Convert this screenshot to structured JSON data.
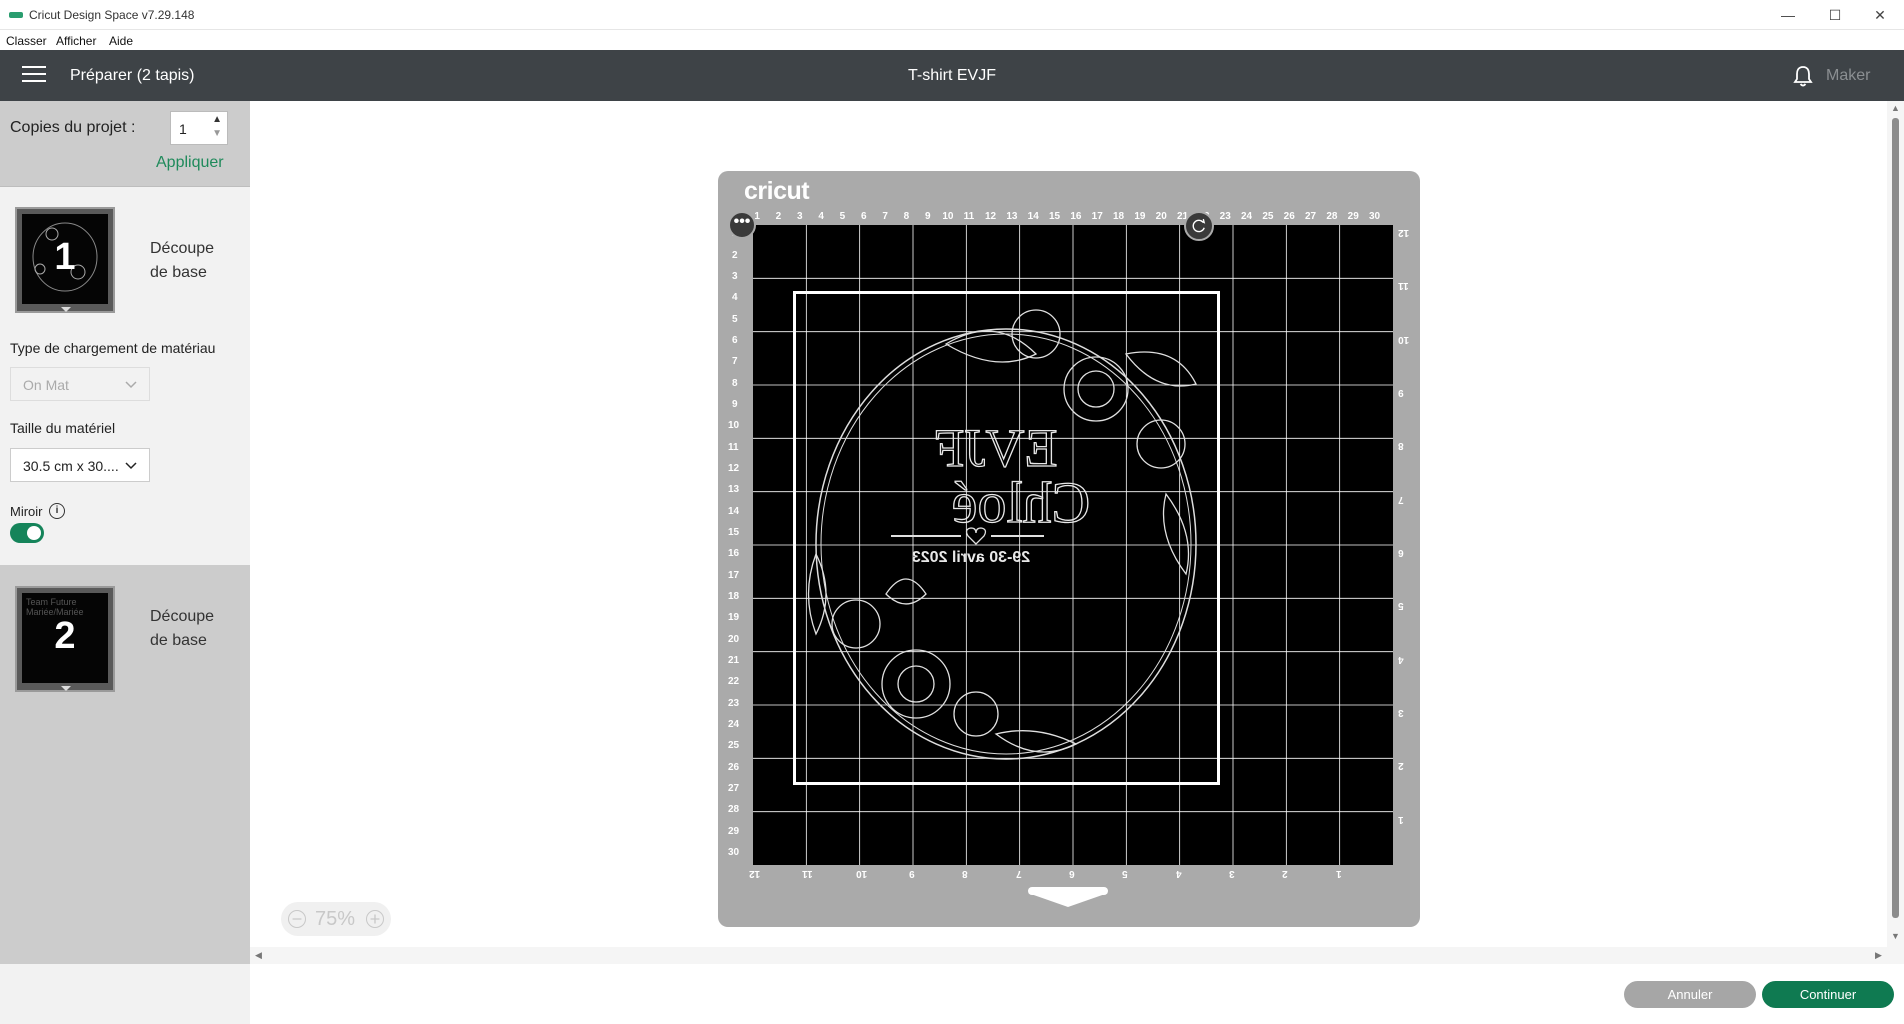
{
  "window": {
    "title": "Cricut Design Space  v7.29.148",
    "minimize": "—",
    "maximize": "☐",
    "close": "✕"
  },
  "menu": {
    "items": [
      "Classer",
      "Afficher",
      "Aide"
    ]
  },
  "header": {
    "left_title": "Préparer (2 tapis)",
    "project_title": "T-shirt EVJF",
    "machine": "Maker"
  },
  "sidebar": {
    "copies_label": "Copies du projet :",
    "copies_value": "1",
    "apply_label": "Appliquer",
    "mats": [
      {
        "number": "1",
        "label_line1": "Découpe",
        "label_line2": "de base"
      },
      {
        "number": "2",
        "label_line1": "Découpe",
        "label_line2": "de base"
      }
    ],
    "load_type_label": "Type de chargement de matériau",
    "load_type_value": "On Mat",
    "material_size_label": "Taille du matériel",
    "material_size_value": "30.5 cm x 30....",
    "mirror_label": "Miroir",
    "mirror_on": true
  },
  "mat": {
    "brand": "cricut",
    "top_ruler": [
      "1",
      "2",
      "3",
      "4",
      "5",
      "6",
      "7",
      "8",
      "9",
      "10",
      "11",
      "12",
      "13",
      "14",
      "15",
      "16",
      "17",
      "18",
      "19",
      "20",
      "21",
      "22",
      "23",
      "24",
      "25",
      "26",
      "27",
      "28",
      "29",
      "30"
    ],
    "left_ruler": [
      "1",
      "2",
      "3",
      "4",
      "5",
      "6",
      "7",
      "8",
      "9",
      "10",
      "11",
      "12",
      "13",
      "14",
      "15",
      "16",
      "17",
      "18",
      "19",
      "20",
      "21",
      "22",
      "23",
      "24",
      "25",
      "26",
      "27",
      "28",
      "29",
      "30"
    ],
    "right_ruler": [
      "12",
      "11",
      "10",
      "9",
      "8",
      "7",
      "6",
      "5",
      "4",
      "3",
      "2",
      "1"
    ],
    "bottom_ruler": [
      "12",
      "11",
      "10",
      "9",
      "8",
      "7",
      "6",
      "5",
      "4",
      "3",
      "2",
      "1"
    ],
    "design_text_line1": "EVJF",
    "design_text_line2": "Chloé",
    "design_text_line3": "29-30 avril 2023",
    "mat2_thumb_text": "Team Future Mariée/Mariée"
  },
  "zoom": {
    "value": "75%"
  },
  "actions": {
    "cancel": "Annuler",
    "continue": "Continuer"
  },
  "colors": {
    "header": "#3e4347",
    "accent": "#0f7a51",
    "link": "#1f8a5b",
    "mat": "#aaaaaa"
  }
}
